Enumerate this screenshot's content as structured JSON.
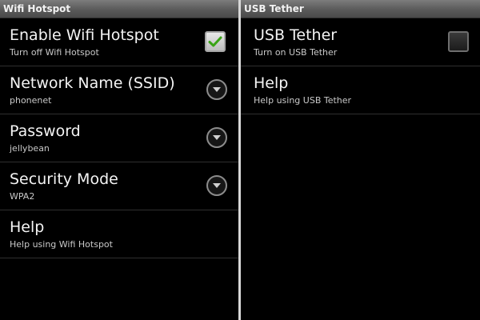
{
  "left_screen": {
    "title": "Wifi Hotspot",
    "items": [
      {
        "title": "Enable Wifi Hotspot",
        "summary": "Turn off Wifi Hotspot",
        "control": "checkbox",
        "checked": true
      },
      {
        "title": "Network Name (SSID)",
        "summary": "phonenet",
        "control": "dropdown"
      },
      {
        "title": "Password",
        "summary": "jellybean",
        "control": "dropdown"
      },
      {
        "title": "Security Mode",
        "summary": "WPA2",
        "control": "dropdown"
      },
      {
        "title": "Help",
        "summary": "Help using Wifi Hotspot",
        "control": "none"
      }
    ]
  },
  "right_screen": {
    "title": "USB Tether",
    "items": [
      {
        "title": "USB Tether",
        "summary": "Turn on USB Tether",
        "control": "checkbox",
        "checked": false
      },
      {
        "title": "Help",
        "summary": "Help using USB Tether",
        "control": "none"
      }
    ]
  },
  "colors": {
    "background": "#000000",
    "check_green": "#3aa416",
    "divider": "#d8d8d8"
  },
  "icons": {
    "checkmark": "checkmark-icon",
    "dropdown": "chevron-down-icon"
  }
}
